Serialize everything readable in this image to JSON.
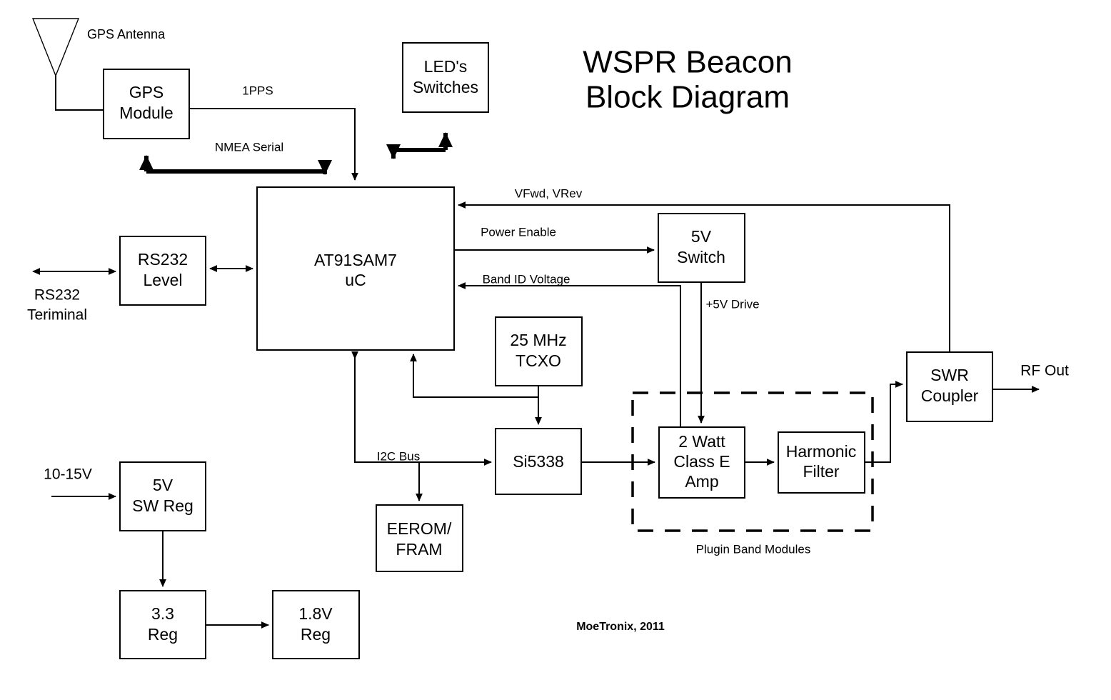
{
  "title": {
    "line1": "WSPR Beacon",
    "line2": "Block Diagram"
  },
  "credit": "MoeTronix, 2011",
  "blocks": {
    "gps_module": {
      "line1": "GPS",
      "line2": "Module"
    },
    "leds_switches": {
      "line1": "LED's",
      "line2": "Switches"
    },
    "uc": {
      "line1": "AT91SAM7",
      "line2": "uC"
    },
    "rs232_level": {
      "line1": "RS232",
      "line2": "Level"
    },
    "tcxo": {
      "line1": "25 MHz",
      "line2": "TCXO"
    },
    "si5338": {
      "line1": "Si5338",
      "line2": ""
    },
    "eerom_fram": {
      "line1": "EEROM/",
      "line2": "FRAM"
    },
    "sw_5v": {
      "line1": "5V",
      "line2": "Switch"
    },
    "amp": {
      "line1": "2 Watt",
      "line2": "Class E",
      "line3": "Amp"
    },
    "harmonic_filter": {
      "line1": "Harmonic",
      "line2": "Filter"
    },
    "swr_coupler": {
      "line1": "SWR",
      "line2": "Coupler"
    },
    "reg_5v_sw": {
      "line1": "5V",
      "line2": "SW Reg"
    },
    "reg_33": {
      "line1": "3.3",
      "line2": "Reg"
    },
    "reg_18": {
      "line1": "1.8V",
      "line2": "Reg"
    }
  },
  "labels": {
    "gps_antenna": "GPS Antenna",
    "one_pps": "1PPS",
    "nmea_serial": "NMEA Serial",
    "vfwd_vrev": "VFwd, VRev",
    "power_enable": "Power Enable",
    "band_id_voltage": "Band ID Voltage",
    "plus5v_drive": "+5V Drive",
    "i2c_bus": "I2C Bus",
    "rs232_terminal_l1": "RS232",
    "rs232_terminal_l2": "Teriminal",
    "input_voltage": "10-15V",
    "rf_out": "RF Out",
    "plugin_band_modules": "Plugin Band Modules"
  },
  "colors": {
    "stroke": "#000000",
    "fill": "#ffffff"
  }
}
